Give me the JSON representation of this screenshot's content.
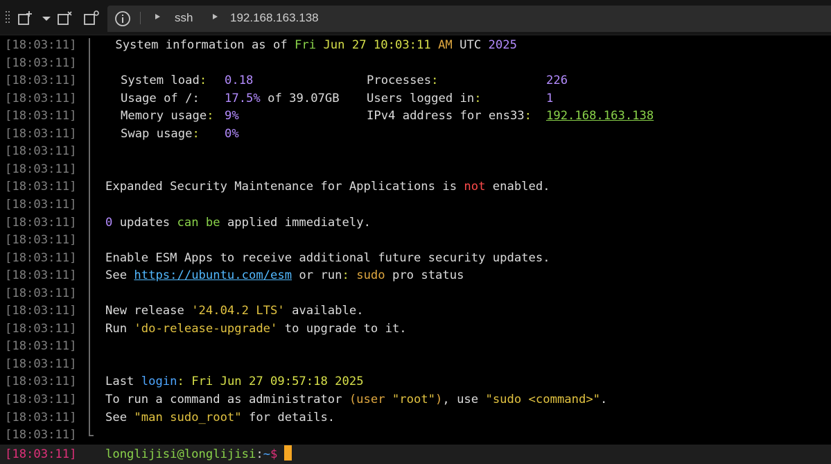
{
  "toolbar": {
    "crumbs": [
      "ssh",
      "192.168.163.138"
    ]
  },
  "timestamp": "[18:03:11]",
  "lines": {
    "sysinfo_prefix": " System information as of ",
    "sysinfo_day": "Fri",
    "sysinfo_mon": "Jun",
    "sysinfo_date": "27",
    "sysinfo_time": "10:03:11",
    "sysinfo_ampm": "AM",
    "sysinfo_tz": "UTC",
    "sysinfo_year": "2025",
    "load_label": "System load",
    "load_value": "0.18",
    "procs_label": "Processes",
    "procs_value": "226",
    "usage_label": "Usage of /:",
    "usage_value": "17.5%",
    "usage_rest": "of 39.07GB",
    "users_label": "Users logged in",
    "users_value": "1",
    "mem_label": "Memory usage",
    "mem_value": "9%",
    "ipv4_label": "IPv4 address for ens33",
    "ipv4_value": "192.168.163.138",
    "swap_label": "Swap usage",
    "swap_value": "0%",
    "esm_a": "Expanded Security Maintenance for Applications is ",
    "esm_not": "not",
    "esm_b": " enabled.",
    "upd_num": "0",
    "upd_a": " updates ",
    "upd_can": "can",
    "upd_be": "be",
    "upd_b": " applied immediately.",
    "enable_esm": "Enable ESM Apps to receive additional future security updates.",
    "see": "See ",
    "esm_url": "https://ubuntu.com/esm",
    "or_run": " or run",
    "sudo": "sudo",
    "pro_status": " pro status",
    "new_release_a": "New release ",
    "new_release_ver": "'24.04.2 LTS'",
    "new_release_b": " available.",
    "run_a": "Run ",
    "run_cmd": "'do-release-upgrade'",
    "run_b": " to upgrade to it.",
    "last": "Last ",
    "login": "login",
    "last_date": "Fri Jun 27 09:57:18 2025",
    "torun_a": "To run a command as administrator ",
    "torun_user": "(user ",
    "torun_root": "\"root\"",
    "torun_paren": ")",
    "torun_use": ", use ",
    "torun_sudo": "\"sudo <command>\"",
    "torun_dot": ".",
    "see_a": "See ",
    "see_man": "\"man sudo_root\"",
    "see_b": " for details.",
    "prompt_user": "longlijisi@longlijisi",
    "prompt_path": "~",
    "prompt_dollar": "$"
  }
}
